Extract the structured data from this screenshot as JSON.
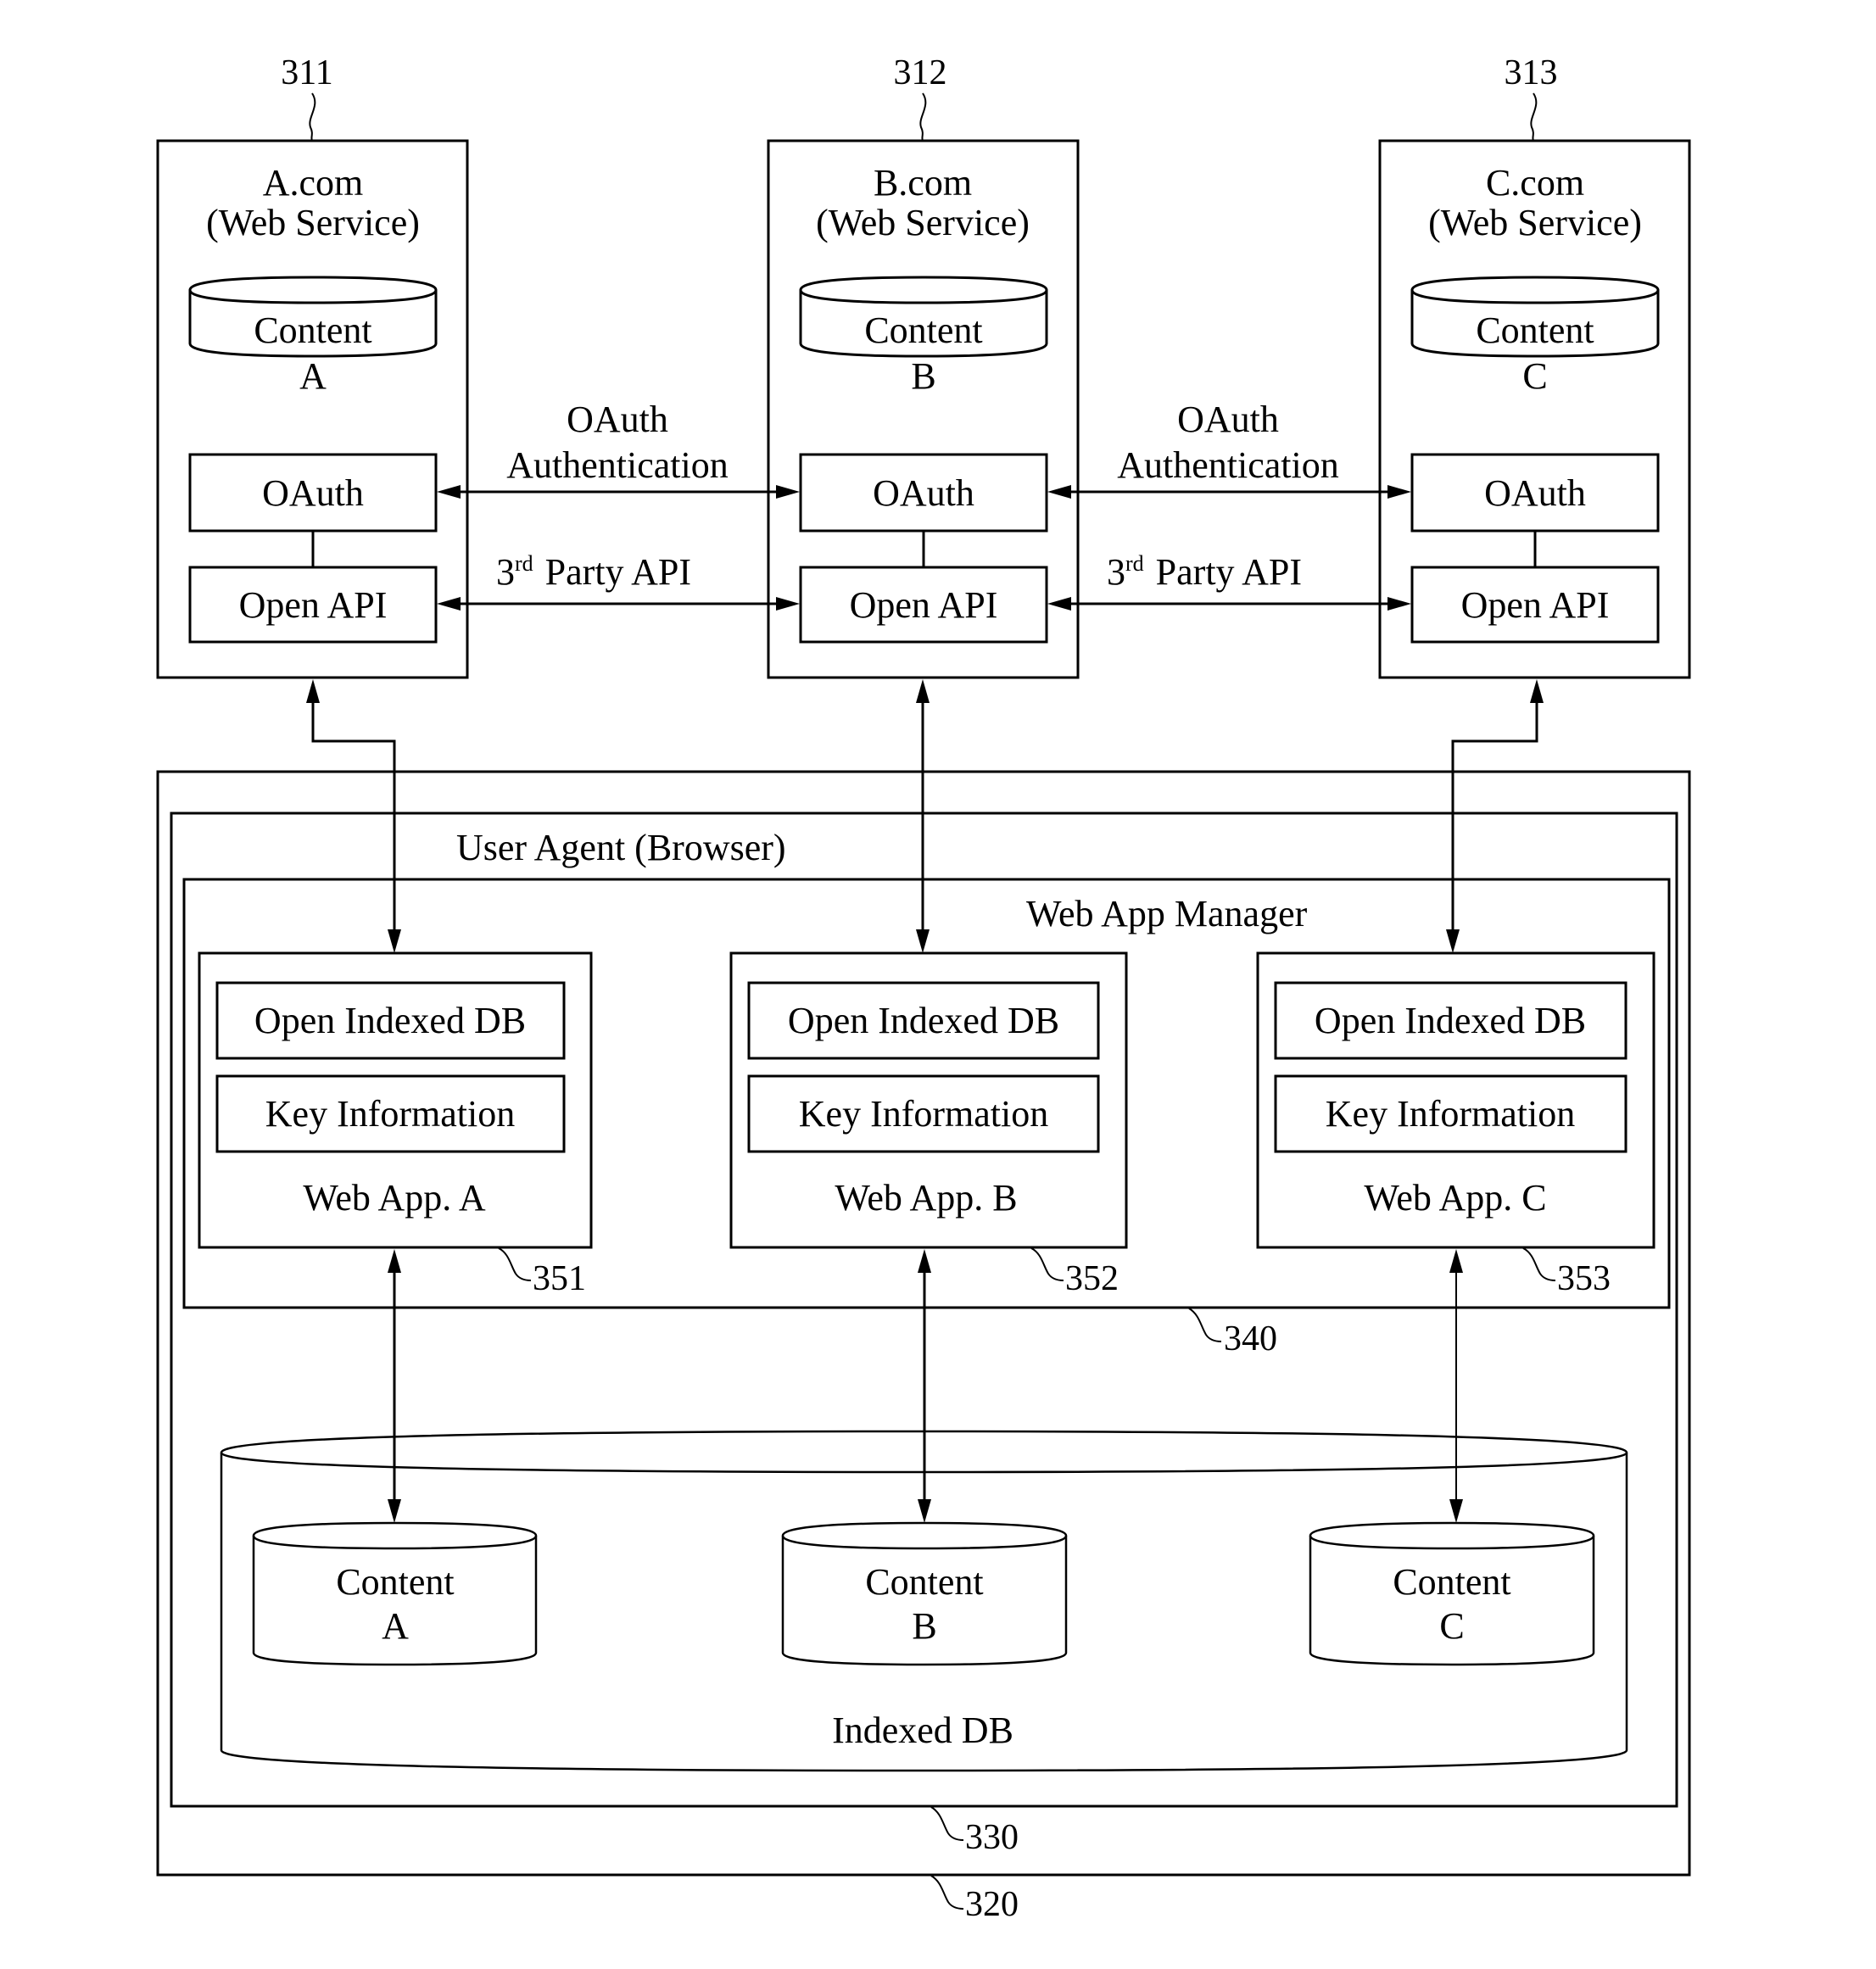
{
  "figure": {
    "stroke_color": "#000000",
    "background_color": "#ffffff"
  },
  "web_services": [
    {
      "ref": "311",
      "name": "A.com",
      "subtitle": "(Web Service)",
      "content_line1": "Content",
      "content_line2": "A",
      "oauth_label": "OAuth",
      "open_api_label": "Open API"
    },
    {
      "ref": "312",
      "name": "B.com",
      "subtitle": "(Web Service)",
      "content_line1": "Content",
      "content_line2": "B",
      "oauth_label": "OAuth",
      "open_api_label": "Open API"
    },
    {
      "ref": "313",
      "name": "C.com",
      "subtitle": "(Web Service)",
      "content_line1": "Content",
      "content_line2": "C",
      "oauth_label": "OAuth",
      "open_api_label": "Open API"
    }
  ],
  "connections": [
    {
      "oauth_line1": "OAuth",
      "oauth_line2": "Authentication",
      "api_base": "3",
      "api_sup": "rd",
      "api_rest": "Party API"
    },
    {
      "oauth_line1": "OAuth",
      "oauth_line2": "Authentication",
      "api_base": "3",
      "api_sup": "rd",
      "api_rest": "Party API"
    }
  ],
  "device": {
    "ref": "320",
    "user_agent": {
      "ref": "330",
      "label": "User Agent (Browser)"
    },
    "web_app_manager": {
      "ref": "340",
      "label": "Web App Manager"
    },
    "web_apps": [
      {
        "ref": "351",
        "open_db_label": "Open Indexed DB",
        "key_info_label": "Key Information",
        "name": "Web App. A"
      },
      {
        "ref": "352",
        "open_db_label": "Open Indexed DB",
        "key_info_label": "Key Information",
        "name": "Web App. B"
      },
      {
        "ref": "353",
        "open_db_label": "Open Indexed DB",
        "key_info_label": "Key Information",
        "name": "Web App. C"
      }
    ],
    "indexed_db": {
      "label": "Indexed DB",
      "stores": [
        {
          "line1": "Content",
          "line2": "A"
        },
        {
          "line1": "Content",
          "line2": "B"
        },
        {
          "line1": "Content",
          "line2": "C"
        }
      ]
    }
  }
}
